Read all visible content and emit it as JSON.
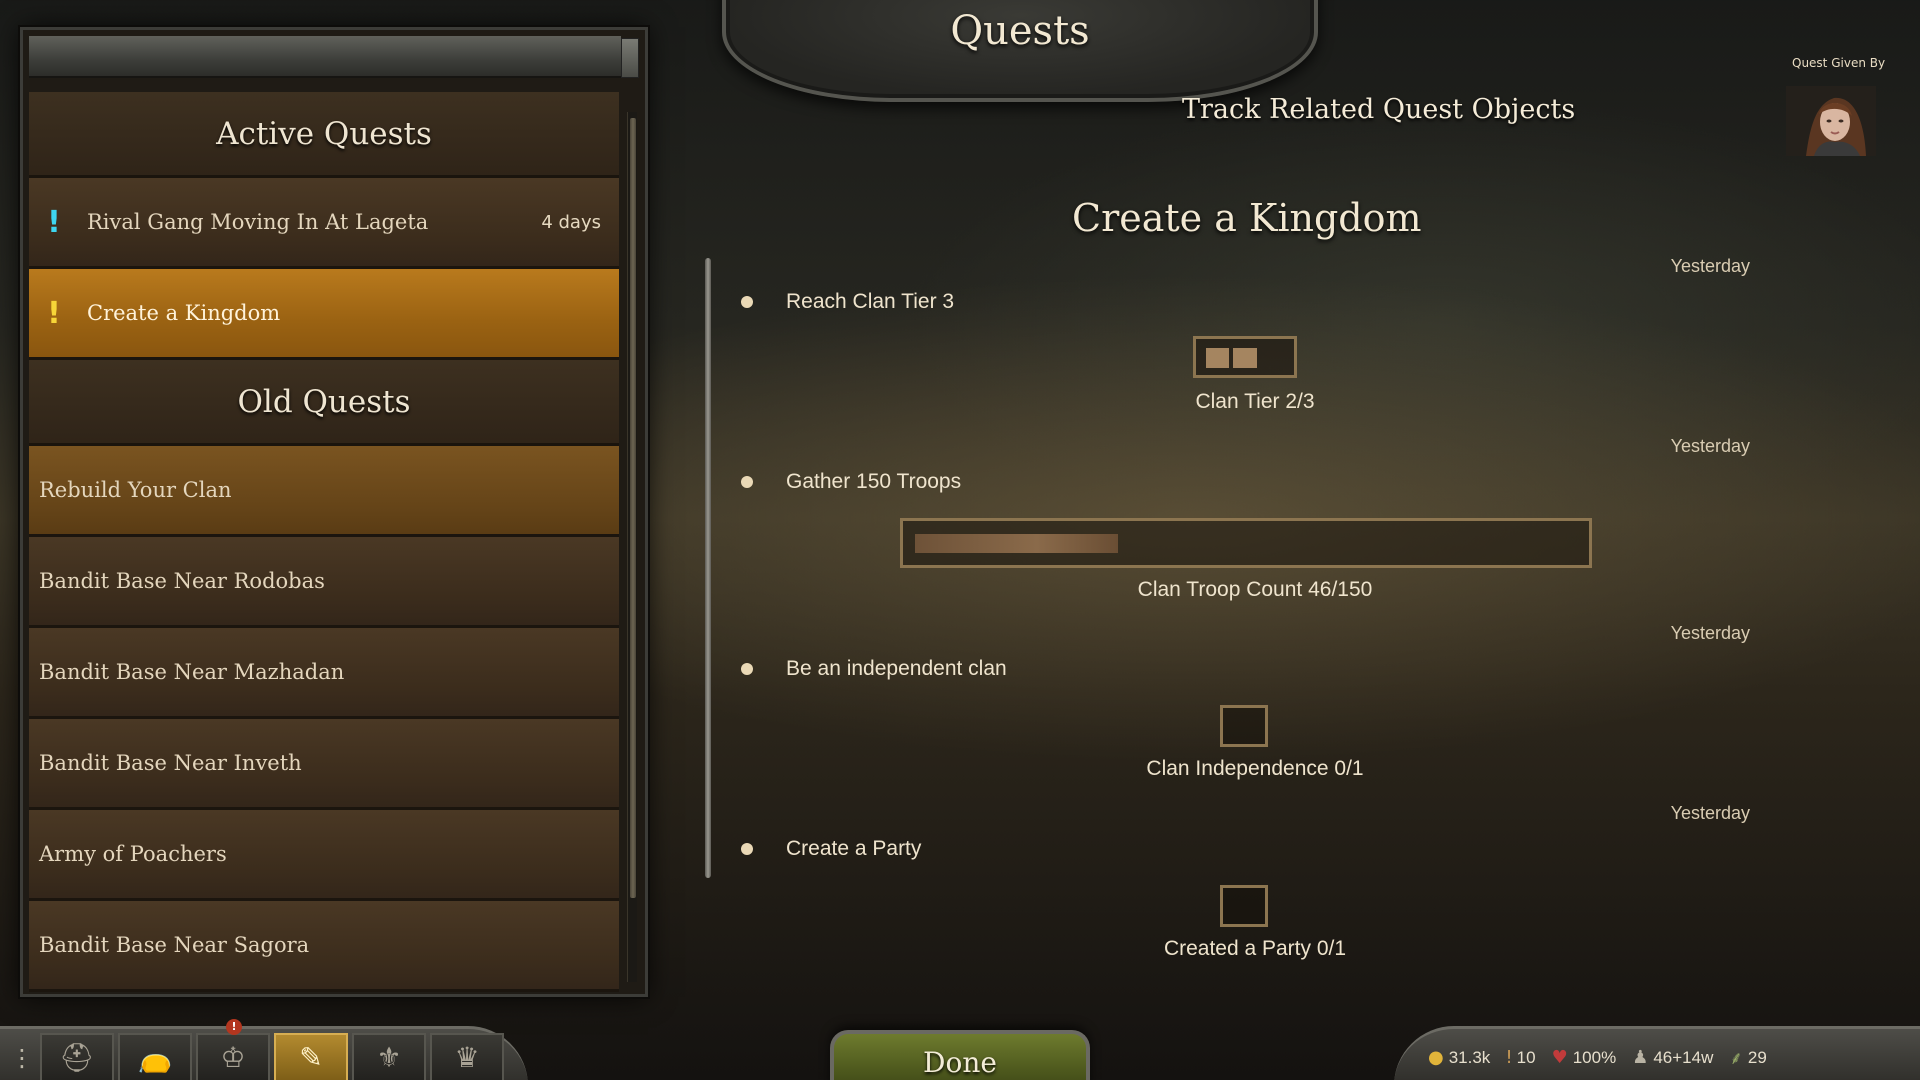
{
  "window": {
    "title": "Quests"
  },
  "header": {
    "track_link": "Track Related Quest Objects",
    "quest_given_by": "Quest Given By"
  },
  "sidebar": {
    "active_heading": "Active Quests",
    "active_quests": [
      {
        "label": "Rival Gang Moving In At Lageta",
        "time": "4 days",
        "marker": "cyan"
      },
      {
        "label": "Create a Kingdom",
        "time": "",
        "marker": "yellow",
        "selected": true
      }
    ],
    "old_heading": "Old Quests",
    "old_quests": [
      {
        "label": "Rebuild Your Clan"
      },
      {
        "label": "Bandit Base Near Rodobas"
      },
      {
        "label": "Bandit Base Near Mazhadan"
      },
      {
        "label": "Bandit Base Near Inveth"
      },
      {
        "label": "Army of Poachers"
      },
      {
        "label": "Bandit Base Near Sagora"
      }
    ]
  },
  "quest": {
    "title": "Create a Kingdom",
    "objectives": [
      {
        "date": "Yesterday",
        "text": "Reach Clan Tier 3",
        "caption": "Clan Tier 2/3",
        "progress_current": 2,
        "progress_total": 3
      },
      {
        "date": "Yesterday",
        "text": "Gather 150 Troops",
        "caption": "Clan Troop Count 46/150",
        "progress_current": 46,
        "progress_total": 150
      },
      {
        "date": "Yesterday",
        "text": "Be an independent clan",
        "caption": "Clan Independence 0/1",
        "progress_current": 0,
        "progress_total": 1
      },
      {
        "date": "Yesterday",
        "text": "Create a Party",
        "caption": "Created a Party 0/1",
        "progress_current": 0,
        "progress_total": 1
      }
    ]
  },
  "footer": {
    "done_label": "Done",
    "menu_icon": "vertical-dots-icon",
    "toolbar_icons": [
      "helmet-icon",
      "bag-icon",
      "party-icon",
      "quest-scroll-icon",
      "clan-banner-icon",
      "kingdom-crown-icon"
    ],
    "stats": {
      "gold": "31.3k",
      "influence": "10",
      "health": "100%",
      "troops": "46+14w",
      "food": "29"
    }
  }
}
